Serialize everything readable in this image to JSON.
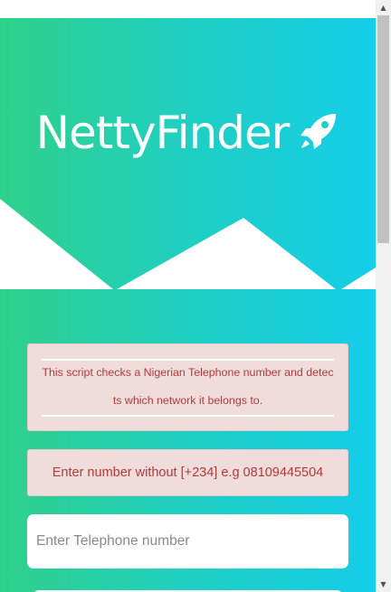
{
  "header": {
    "title": "NettyFinder",
    "icon": "rocket-icon"
  },
  "notice": {
    "text": "This script checks a Nigerian Telephone number and detects which network it belongs to."
  },
  "hint": {
    "text": "Enter number without [+234] e.g 08109445504"
  },
  "phone_input": {
    "value": "",
    "placeholder": "Enter Telephone number"
  },
  "scrollbar": {
    "up_arrow": "▲",
    "down_arrow": "▼"
  },
  "colors": {
    "gradient_start": "#2fd18a",
    "gradient_end": "#14cdea",
    "notice_bg": "#f1dcdc",
    "notice_text": "#b23a3a"
  }
}
